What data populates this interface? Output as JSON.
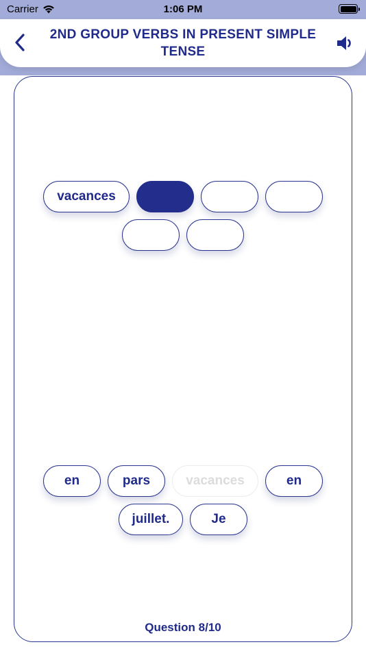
{
  "status": {
    "carrier": "Carrier",
    "time": "1:06 PM"
  },
  "header": {
    "title": "2ND GROUP VERBS IN PRESENT SIMPLE TENSE"
  },
  "answer_slots": [
    {
      "text": "vacances",
      "state": "filled-text"
    },
    {
      "text": "",
      "state": "active"
    },
    {
      "text": "",
      "state": "empty"
    },
    {
      "text": "",
      "state": "empty"
    },
    {
      "text": "",
      "state": "empty"
    },
    {
      "text": "",
      "state": "empty"
    }
  ],
  "word_bank": [
    {
      "text": "en",
      "used": false
    },
    {
      "text": "pars",
      "used": false
    },
    {
      "text": "vacances",
      "used": true
    },
    {
      "text": "en",
      "used": false
    },
    {
      "text": "juillet.",
      "used": false
    },
    {
      "text": "Je",
      "used": false
    }
  ],
  "footer": {
    "question_counter": "Question 8/10"
  },
  "colors": {
    "accent": "#1f2a8a",
    "status_bar": "#a3acd9"
  }
}
